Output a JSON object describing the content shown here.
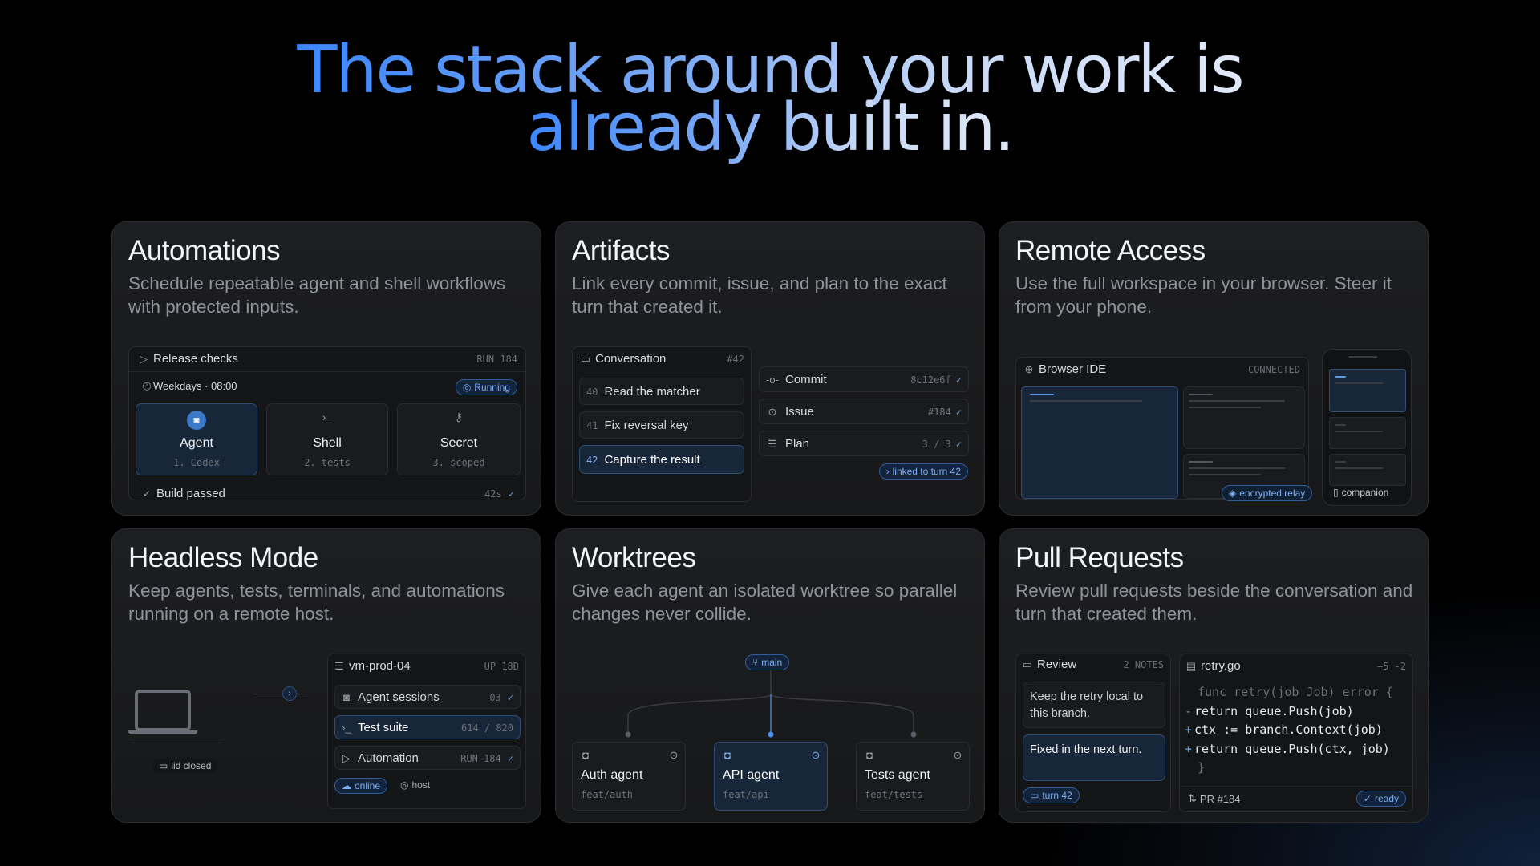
{
  "hero": {
    "line1": "The stack around your work is",
    "line2": "already built in."
  },
  "automations": {
    "title": "Automations",
    "desc": "Schedule repeatable agent and shell workflows with protected inputs.",
    "panel_title": "Release checks",
    "run": "RUN 184",
    "schedule": "Weekdays · 08:00",
    "status": "Running",
    "steps": [
      {
        "label": "Agent",
        "sub": "1. Codex",
        "icon": "robot-icon"
      },
      {
        "label": "Shell",
        "sub": "2. tests",
        "icon": "terminal-icon"
      },
      {
        "label": "Secret",
        "sub": "3. scoped",
        "icon": "key-icon"
      }
    ],
    "result": "Build passed",
    "duration": "42s"
  },
  "artifacts": {
    "title": "Artifacts",
    "desc": "Link every commit, issue, and plan to the exact turn that created it.",
    "conversation_title": "Conversation",
    "conversation_id": "#42",
    "turns": [
      {
        "num": "40",
        "label": "Read the matcher"
      },
      {
        "num": "41",
        "label": "Fix reversal key"
      },
      {
        "num": "42",
        "label": "Capture the result"
      }
    ],
    "links": [
      {
        "label": "Commit",
        "value": "8c12e6f",
        "icon": "commit-icon"
      },
      {
        "label": "Issue",
        "value": "#184",
        "icon": "issue-icon"
      },
      {
        "label": "Plan",
        "value": "3 / 3",
        "icon": "list-icon"
      }
    ],
    "linked": "linked to turn 42"
  },
  "remote": {
    "title": "Remote Access",
    "desc": "Use the full workspace in your browser. Steer it from your phone.",
    "browser_title": "Browser IDE",
    "status": "CONNECTED",
    "relay": "encrypted relay",
    "companion": "companion"
  },
  "headless": {
    "title": "Headless Mode",
    "desc": "Keep agents, tests, terminals, and automations running on a remote host.",
    "laptop_label": "lid closed",
    "host_name": "vm-prod-04",
    "uptime": "UP 18D",
    "rows": [
      {
        "label": "Agent sessions",
        "value": "03",
        "icon": "robot-icon"
      },
      {
        "label": "Test suite",
        "value": "614 / 820",
        "icon": "terminal-icon"
      },
      {
        "label": "Automation",
        "value": "RUN 184",
        "icon": "play-icon"
      }
    ],
    "online": "online",
    "host": "host"
  },
  "worktrees": {
    "title": "Worktrees",
    "desc": "Give each agent an isolated worktree so parallel changes never collide.",
    "branch": "main",
    "agents": [
      {
        "label": "Auth agent",
        "branch": "feat/auth"
      },
      {
        "label": "API agent",
        "branch": "feat/api"
      },
      {
        "label": "Tests agent",
        "branch": "feat/tests"
      }
    ]
  },
  "pulls": {
    "title": "Pull Requests",
    "desc": "Review pull requests beside the conversation and turn that created them.",
    "review_title": "Review",
    "notes": "2 NOTES",
    "note1": "Keep the retry local to this branch.",
    "note2": "Fixed in the next turn.",
    "turn": "turn 42",
    "file": "retry.go",
    "diffstat": "+5 -2",
    "code": [
      {
        "sign": "",
        "text": "func retry(job Job) error {"
      },
      {
        "sign": "-",
        "text": "return queue.Push(job)"
      },
      {
        "sign": "+",
        "text": "ctx := branch.Context(job)"
      },
      {
        "sign": "+",
        "text": "return queue.Push(ctx, job)"
      },
      {
        "sign": "",
        "text": "}"
      }
    ],
    "pr": "PR #184",
    "ready": "ready"
  },
  "colors": {
    "accent": "#3b86ff",
    "card": "#1b1c1f",
    "check": "#6c9de0"
  }
}
